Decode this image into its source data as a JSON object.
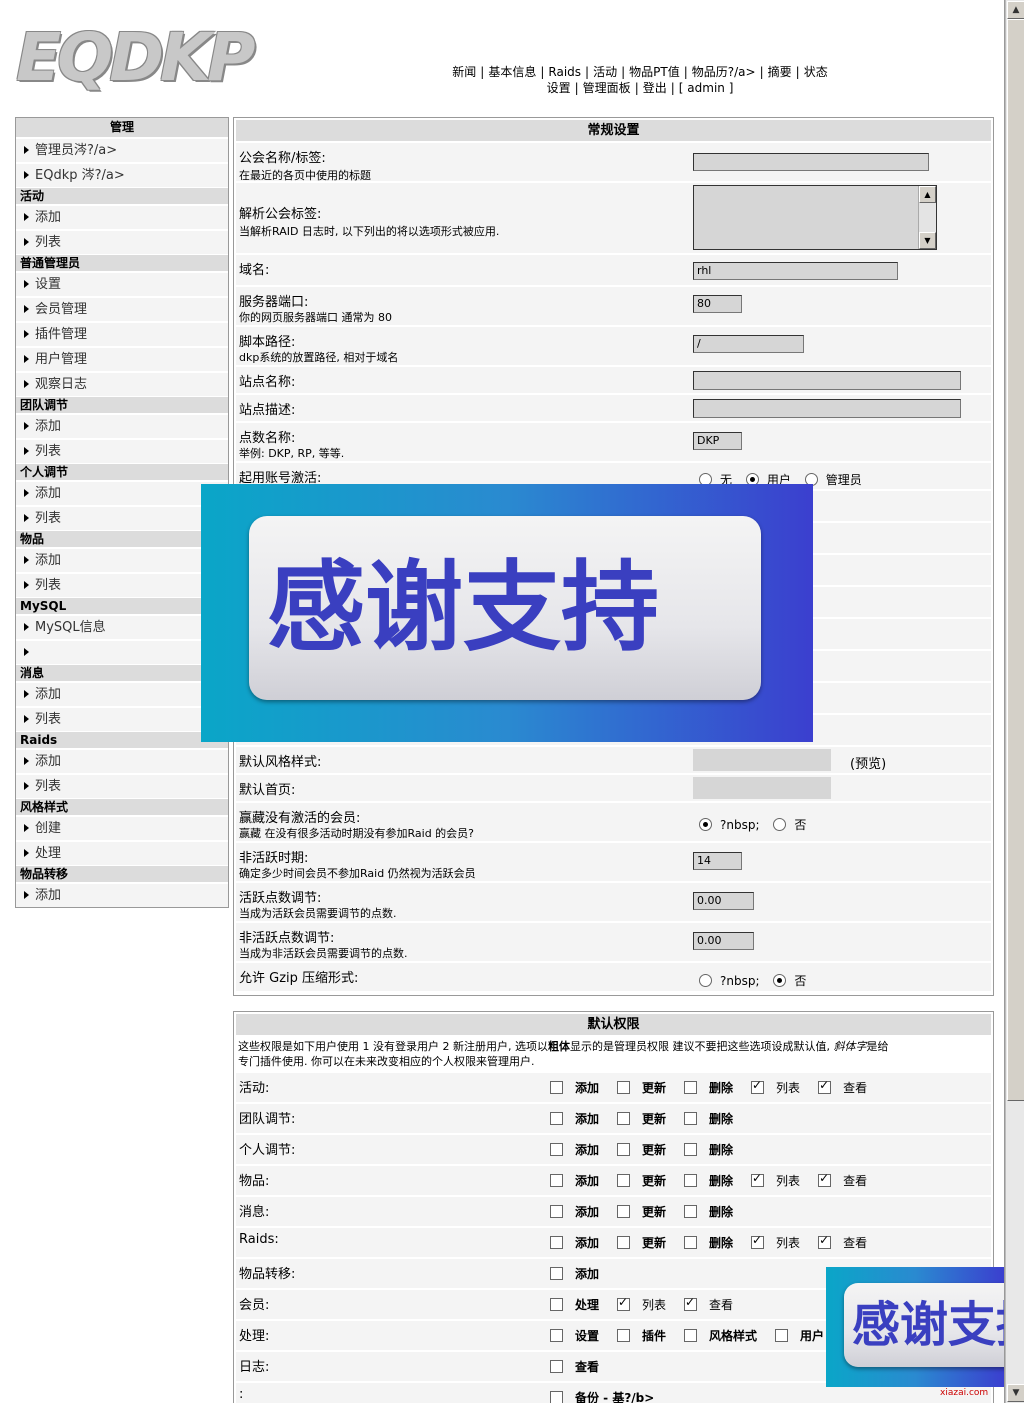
{
  "logo": "EQDKP",
  "top_nav": {
    "line1": [
      "新闻",
      "基本信息",
      "Raids",
      "活动",
      "物品PT值",
      "物品历?/a>",
      "摘要",
      "状态"
    ],
    "line2": [
      "设置",
      "管理面板",
      "登出",
      "[ admin ]"
    ]
  },
  "sidebar": {
    "title": "管理",
    "sections": [
      {
        "label": "",
        "items": [
          "管理员涔?/a>",
          "EQdkp 涔?/a>"
        ]
      },
      {
        "label": "活动",
        "items": [
          "添加",
          "列表"
        ]
      },
      {
        "label": "普通管理员",
        "items": [
          "设置",
          "会员管理",
          "插件管理",
          "用户管理",
          "观察日志"
        ]
      },
      {
        "label": "团队调节",
        "items": [
          "添加",
          "列表"
        ]
      },
      {
        "label": "个人调节",
        "items": [
          "添加",
          "列表"
        ]
      },
      {
        "label": "物品",
        "items": [
          "添加",
          "列表"
        ]
      },
      {
        "label": "MySQL",
        "items": [
          "MySQL信息",
          ""
        ]
      },
      {
        "label": "消息",
        "items": [
          "添加",
          "列表"
        ]
      },
      {
        "label": "Raids",
        "items": [
          "添加",
          "列表"
        ]
      },
      {
        "label": "风格样式",
        "items": [
          "创建",
          "处理"
        ]
      },
      {
        "label": "物品转移",
        "items": [
          "添加"
        ]
      }
    ]
  },
  "general": {
    "title": "常规设置",
    "guild_name_label": "公会名称/标签:",
    "guild_name_desc": "在最近的各页中使用的标题",
    "parse_tags_label": "解析公会标签:",
    "parse_tags_desc": "当解析RAID 日志时, 以下列出的将以选项形式被应用.",
    "domain_label": "域名:",
    "domain_value": "rhl",
    "port_label": "服务器端口:",
    "port_desc": "你的网页服务器端口 通常为 80",
    "port_value": "80",
    "path_label": "脚本路径:",
    "path_desc": "dkp系统的放置路径, 相对于域名",
    "path_value": "/",
    "site_name_label": "站点名称:",
    "site_desc_label": "站点描述:",
    "points_label": "点数名称:",
    "points_desc": "举例: DKP, RP, 等等.",
    "points_value": "DKP",
    "activation_label": "起用账号激活:",
    "activation_options": [
      "无",
      "用户",
      "管理员"
    ],
    "style_label": "默认风格样式:",
    "style_preview": "(预览)",
    "home_label": "默认首页:",
    "hide_inactive_label": "赢藏没有激活的会员:",
    "hide_inactive_desc": "赢藏 在没有很多活动时期没有参加Raid 的会员?",
    "yes_no": [
      "?nbsp;",
      "否"
    ],
    "inactive_period_label": "非活跃时期:",
    "inactive_period_desc": "确定多少时间会员不参加Raid 仍然视为活跃会员",
    "inactive_period_value": "14",
    "active_adj_label": "活跃点数调节:",
    "active_adj_desc": "当成为活跃会员需要调节的点数.",
    "active_adj_value": "0.00",
    "inactive_adj_label": "非活跃点数调节:",
    "inactive_adj_desc": "当成为非活跃会员需要调节的点数.",
    "inactive_adj_value": "0.00",
    "gzip_label": "允许 Gzip 压缩形式:"
  },
  "perms": {
    "title": "默认权限",
    "intro_line1_a": "这些权限是如下用户使用 1 没有登录用户 2 新注册用户, 选项以",
    "intro_bold": "粗体",
    "intro_line1_b": "显示的是管理员权限 建议不要把这些选项设成默认值,",
    "intro_italic": "斜体字",
    "intro_line1_c": "是给",
    "intro_line2": "专门插件使用. 你可以在未来改变相应的个人权限来管理用户.",
    "rows": [
      {
        "label": "活动:",
        "opts": [
          {
            "t": "添加",
            "b": true,
            "c": false
          },
          {
            "t": "更新",
            "b": true,
            "c": false
          },
          {
            "t": "删除",
            "b": true,
            "c": false
          },
          {
            "t": "列表",
            "b": false,
            "c": true
          },
          {
            "t": "查看",
            "b": false,
            "c": true
          }
        ]
      },
      {
        "label": "团队调节:",
        "opts": [
          {
            "t": "添加",
            "b": true,
            "c": false
          },
          {
            "t": "更新",
            "b": true,
            "c": false
          },
          {
            "t": "删除",
            "b": true,
            "c": false
          }
        ]
      },
      {
        "label": "个人调节:",
        "opts": [
          {
            "t": "添加",
            "b": true,
            "c": false
          },
          {
            "t": "更新",
            "b": true,
            "c": false
          },
          {
            "t": "删除",
            "b": true,
            "c": false
          }
        ]
      },
      {
        "label": "物品:",
        "opts": [
          {
            "t": "添加",
            "b": true,
            "c": false
          },
          {
            "t": "更新",
            "b": true,
            "c": false
          },
          {
            "t": "删除",
            "b": true,
            "c": false
          },
          {
            "t": "列表",
            "b": false,
            "c": true
          },
          {
            "t": "查看",
            "b": false,
            "c": true
          }
        ]
      },
      {
        "label": "消息:",
        "opts": [
          {
            "t": "添加",
            "b": true,
            "c": false
          },
          {
            "t": "更新",
            "b": true,
            "c": false
          },
          {
            "t": "删除",
            "b": true,
            "c": false
          }
        ]
      },
      {
        "label": "Raids:",
        "opts": [
          {
            "t": "添加",
            "b": true,
            "c": false
          },
          {
            "t": "更新",
            "b": true,
            "c": false
          },
          {
            "t": "删除",
            "b": true,
            "c": false
          },
          {
            "t": "列表",
            "b": false,
            "c": true
          },
          {
            "t": "查看",
            "b": false,
            "c": true
          }
        ]
      },
      {
        "label": "物品转移:",
        "opts": [
          {
            "t": "添加",
            "b": true,
            "c": false
          }
        ]
      },
      {
        "label": "会员:",
        "opts": [
          {
            "t": "处理",
            "b": true,
            "c": false
          },
          {
            "t": "列表",
            "b": false,
            "c": true
          },
          {
            "t": "查看",
            "b": false,
            "c": true
          }
        ]
      },
      {
        "label": "处理:",
        "opts": [
          {
            "t": "设置",
            "b": true,
            "c": false
          },
          {
            "t": "插件",
            "b": true,
            "c": false
          },
          {
            "t": "风格样式",
            "b": true,
            "c": false
          },
          {
            "t": "用户",
            "b": true,
            "c": false
          }
        ]
      },
      {
        "label": "日志:",
        "opts": [
          {
            "t": "查看",
            "b": true,
            "c": false
          }
        ]
      },
      {
        "label": ":",
        "opts": [
          {
            "t": "备份 - 基?/b>",
            "b": true,
            "c": false
          }
        ]
      }
    ]
  },
  "ad_text": "感谢支持",
  "watermark": "xiazai.com",
  "colors": {
    "ad_text": "#3a3fc0",
    "panel_header": "#dcdcdc",
    "row_bg": "#f4f4f4"
  }
}
